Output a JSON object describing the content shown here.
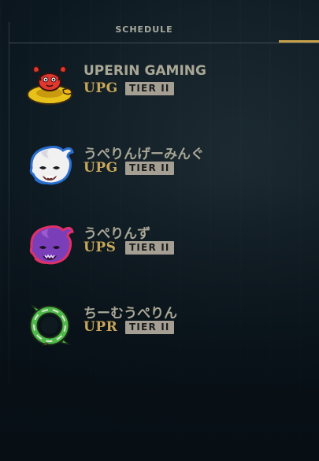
{
  "tabs": {
    "schedule_label": "SCHEDULE"
  },
  "colors": {
    "accent": "#c8a04a",
    "team_name": "#a9a796",
    "team_abbr": "#c8a75a",
    "tier_badge_bg": "#a59f93"
  },
  "teams": [
    {
      "name": "UPERIN GAMING",
      "abbr": "UPG",
      "tier": "TIER II",
      "icon": "crab-duck-icon"
    },
    {
      "name": "うぺりんげーみんぐ",
      "abbr": "UPG",
      "tier": "TIER II",
      "icon": "white-ghost-icon"
    },
    {
      "name": "うぺりんず",
      "abbr": "UPS",
      "tier": "TIER II",
      "icon": "purple-ghost-icon"
    },
    {
      "name": "ちーむうぺりん",
      "abbr": "UPR",
      "tier": "TIER II",
      "icon": "green-ring-icon"
    }
  ]
}
